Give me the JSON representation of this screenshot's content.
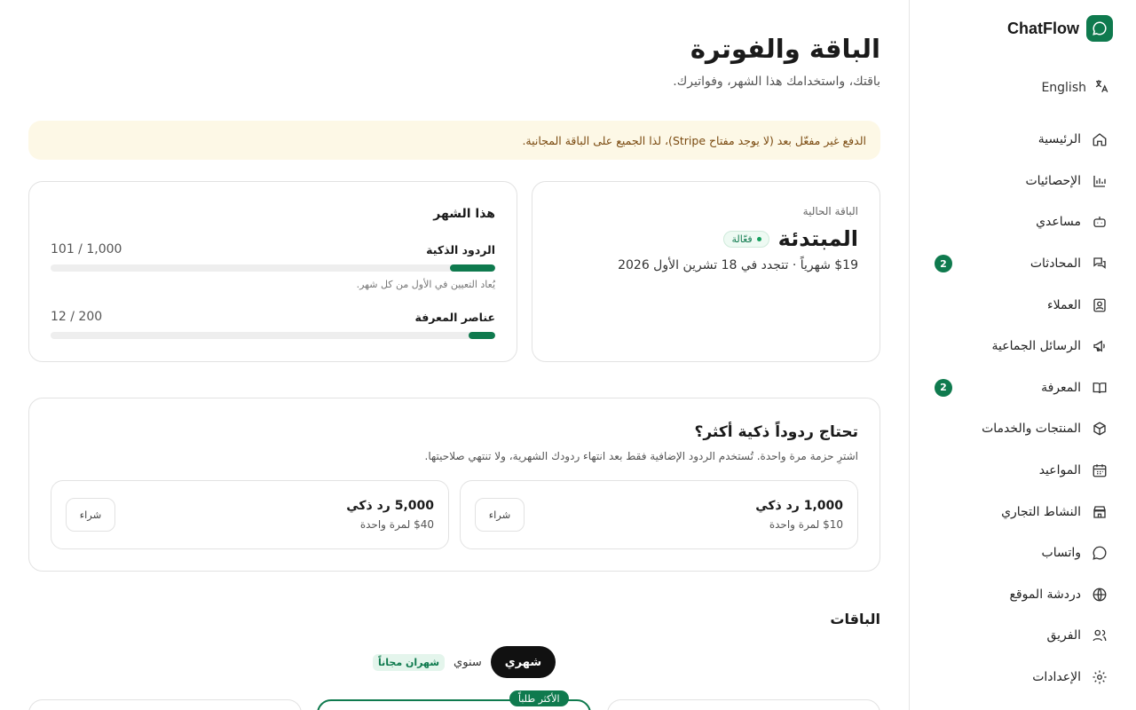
{
  "brand": {
    "name": "ChatFlow"
  },
  "language": {
    "label": "English"
  },
  "sidebar": {
    "items": [
      {
        "label": "الرئيسية",
        "icon": "home-icon"
      },
      {
        "label": "الإحصائيات",
        "icon": "chart-icon"
      },
      {
        "label": "مساعدي",
        "icon": "bot-icon"
      },
      {
        "label": "المحادثات",
        "icon": "chat-icon",
        "badge": "2"
      },
      {
        "label": "العملاء",
        "icon": "contact-icon"
      },
      {
        "label": "الرسائل الجماعية",
        "icon": "megaphone-icon"
      },
      {
        "label": "المعرفة",
        "icon": "book-icon",
        "badge": "2"
      },
      {
        "label": "المنتجات والخدمات",
        "icon": "box-icon"
      },
      {
        "label": "المواعيد",
        "icon": "calendar-icon"
      },
      {
        "label": "النشاط التجاري",
        "icon": "store-icon"
      },
      {
        "label": "واتساب",
        "icon": "whatsapp-icon"
      },
      {
        "label": "دردشة الموقع",
        "icon": "globe-icon"
      },
      {
        "label": "الفريق",
        "icon": "team-icon"
      },
      {
        "label": "الإعدادات",
        "icon": "gear-icon"
      }
    ]
  },
  "page": {
    "title": "الباقة والفوترة",
    "subtitle": "باقتك، واستخدامك هذا الشهر، وفواتيرك."
  },
  "alert": {
    "text": "الدفع غير مفعّل بعد (لا يوجد مفتاح Stripe)، لذا الجميع على الباقة المجانية."
  },
  "current_plan": {
    "label": "الباقة الحالية",
    "name": "المبتدئة",
    "status": "فعّالة",
    "price_line": "$19 شهرياً · تتجدد في 18 تشرين الأول 2026"
  },
  "this_month": {
    "title": "هذا الشهر",
    "smart_replies": {
      "label": "الردود الذكية",
      "value": "101 / 1,000",
      "fraction": 0.101,
      "note": "يُعاد التعيين في الأول من كل شهر."
    },
    "knowledge": {
      "label": "عناصر المعرفة",
      "value": "12 / 200",
      "fraction": 0.06
    }
  },
  "addons": {
    "title": "تحتاج ردوداً ذكية أكثر؟",
    "subtitle": "اشترِ حزمة مرة واحدة. تُستخدم الردود الإضافية فقط بعد انتهاء ردودك الشهرية، ولا تنتهي صلاحيتها.",
    "packs": [
      {
        "name": "1,000 رد ذكي",
        "price": "$10 لمرة واحدة",
        "button": "شراء"
      },
      {
        "name": "5,000 رد ذكي",
        "price": "$40 لمرة واحدة",
        "button": "شراء"
      }
    ]
  },
  "plans": {
    "title": "الباقات",
    "toggle_monthly": "شهري",
    "toggle_yearly": "سنوي",
    "yearly_badge": "شهران مجاناً",
    "popular_badge": "الأكثر طلباً"
  },
  "colors": {
    "accent": "#0f7a4e",
    "alert_bg": "#fdf8e6",
    "alert_text": "#7a4a10"
  }
}
